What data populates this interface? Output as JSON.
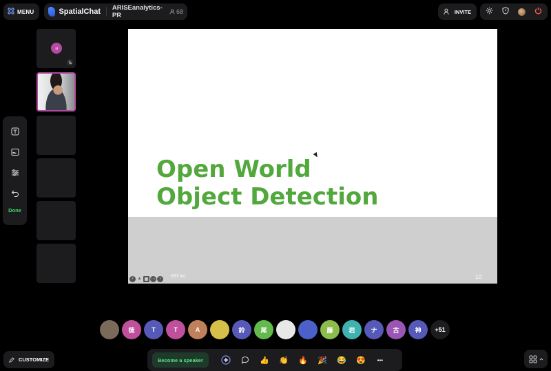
{
  "topbar": {
    "menu_label": "MENU",
    "brand": "SpatialChat",
    "space_name": "ARISEanalytics-PR",
    "participant_count": "68",
    "invite_label": "INVITE"
  },
  "sidebar": {
    "tile_initial": "ヨ",
    "done_label": "Done"
  },
  "slide": {
    "title": "Open World\nObject Detection",
    "footer_text": "EBT Inc.",
    "page_number": "10",
    "colors": {
      "title": "#52a83c",
      "band": "#cfcfd0"
    }
  },
  "participants": [
    {
      "label": "",
      "color": "#7a6a5a"
    },
    {
      "label": "徳",
      "color": "#c04f9c"
    },
    {
      "label": "T",
      "color": "#5659b8"
    },
    {
      "label": "T",
      "color": "#c04f9c"
    },
    {
      "label": "A",
      "color": "#c0805b"
    },
    {
      "label": "",
      "color": "#d6c04a"
    },
    {
      "label": "鈴",
      "color": "#5659b8"
    },
    {
      "label": "尾",
      "color": "#62b94c"
    },
    {
      "label": "",
      "color": "#e8e8e8"
    },
    {
      "label": "",
      "color": "#4b61c9"
    },
    {
      "label": "藤",
      "color": "#8cbd4c"
    },
    {
      "label": "岩",
      "color": "#3fb2b0"
    },
    {
      "label": "ナ",
      "color": "#5659b8"
    },
    {
      "label": "古",
      "color": "#9a55b5"
    },
    {
      "label": "神",
      "color": "#5659b8"
    }
  ],
  "more_participants": "+51",
  "bottombar": {
    "customize_label": "CUSTOMIZE",
    "speaker_label": "Become a speaker",
    "reactions": [
      "👍",
      "👏",
      "🔥",
      "🎉",
      "😂",
      "😍"
    ],
    "more_label": "•••"
  }
}
